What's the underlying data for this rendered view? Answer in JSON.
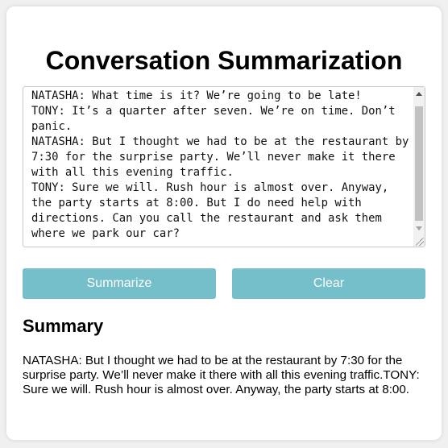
{
  "page": {
    "title": "Conversation Summarization"
  },
  "input": {
    "text": "NATASHA: What time is it? We’re going to be late!\nTONY: It’s a quarter after seven. We’re on time. Don’t panic.\nNATASHA: But I thought we had to be at the restaurant by 7:30 for the surprise party. We’ll never make it there with all this evening traffic.\nTONY: Sure we will. Rush hour is almost over. Anyway, the party starts at 8:00. But I do need help with directions. Can you call the restaurant and ask them where we park our car?"
  },
  "buttons": {
    "summarize_label": "Summarize",
    "clear_label": "Clear"
  },
  "summary": {
    "heading": "Summary",
    "text": "NATASHA: But I thought we had to be at the restaurant by 7:30 for the surprise party. We’ll never make it there with all this evening traffic.TONY: Sure we will. Rush hour is almost over. Anyway, the party starts at 8:00."
  },
  "colors": {
    "button": "#74bfc9",
    "button_text": "#ffffff",
    "card": "#ffffff",
    "background": "#f0f0f0"
  }
}
